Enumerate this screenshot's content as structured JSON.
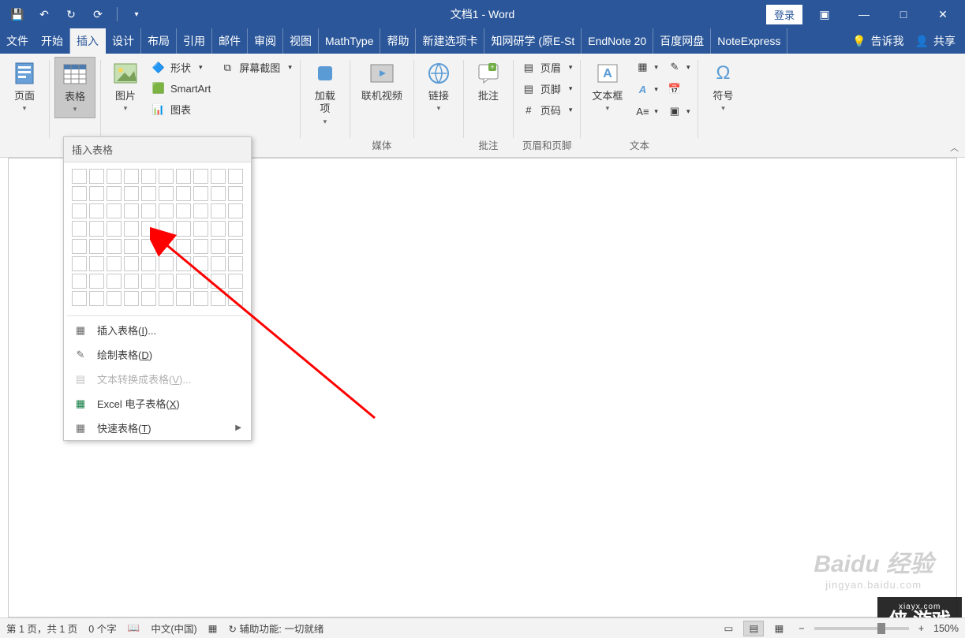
{
  "title": "文档1  -  Word",
  "qat": {
    "login": "登录"
  },
  "tabs": [
    "文件",
    "开始",
    "插入",
    "设计",
    "布局",
    "引用",
    "邮件",
    "审阅",
    "视图",
    "MathType",
    "帮助",
    "新建选项卡",
    "知网研学 (原E-St",
    "EndNote 20",
    "百度网盘",
    "NoteExpress"
  ],
  "active_tab_index": 2,
  "tell_me": "告诉我",
  "share": "共享",
  "ribbon": {
    "page": {
      "label": "页面"
    },
    "table": {
      "label": "表格"
    },
    "pic": {
      "label": "图片"
    },
    "shapes": "形状",
    "smartart": "SmartArt",
    "chart": "图表",
    "screenshot": "屏幕截图",
    "addins": {
      "label": "加载\n项"
    },
    "video": {
      "label": "联机视频"
    },
    "media": "媒体",
    "links": {
      "label": "链接"
    },
    "comment": {
      "label": "批注"
    },
    "comment_grp": "批注",
    "header": "页眉",
    "footer": "页脚",
    "pagenum": "页码",
    "hf_grp": "页眉和页脚",
    "textbox": {
      "label": "文本框"
    },
    "text_grp": "文本",
    "symbol": {
      "label": "符号"
    }
  },
  "dropdown": {
    "title": "插入表格",
    "insert": "插入表格(I)...",
    "draw": "绘制表格(D)",
    "convert": "文本转换成表格(V)...",
    "excel": "Excel 电子表格(X)",
    "quick": "快速表格(T)"
  },
  "statusbar": {
    "pages": "第 1 页，共 1 页",
    "words": "0 个字",
    "lang": "中文(中国)",
    "a11y": "辅助功能: 一切就绪",
    "zoom": "150%"
  },
  "watermark": {
    "baidu": "Baidu 经验",
    "baidu_sub": "jingyan.baidu.com",
    "xia": "侠 游戏",
    "xia_sub": "xiayx.com"
  }
}
